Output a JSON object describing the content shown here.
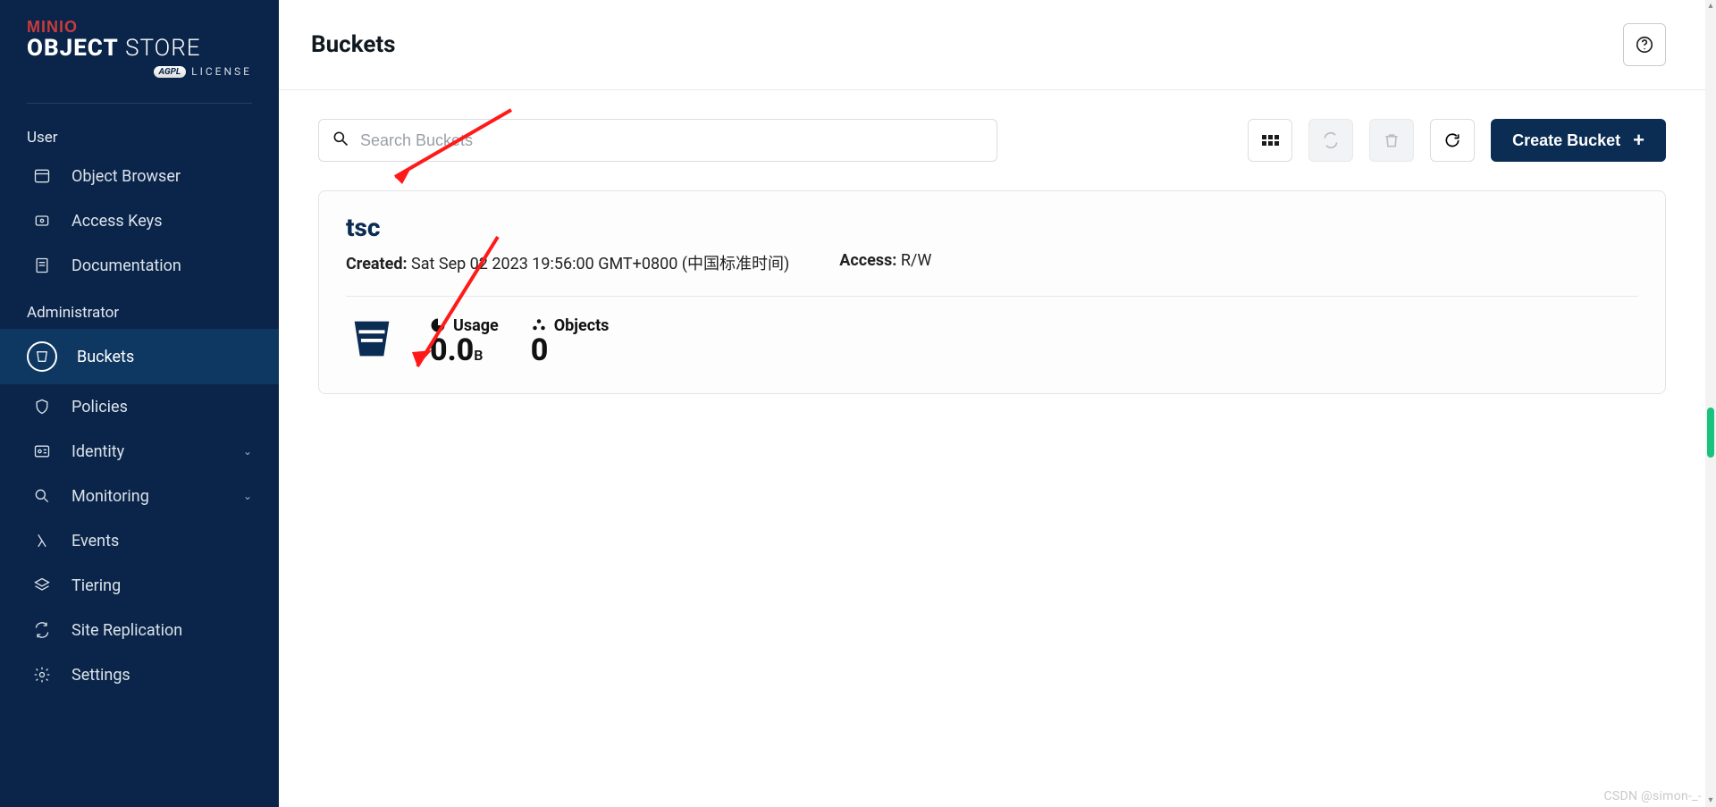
{
  "logo": {
    "brand": "MINIO",
    "title_bold": "OBJECT",
    "title_light": " STORE",
    "agpl_badge": "AGPL",
    "license_txt": "LICENSE"
  },
  "sidebar": {
    "section_user": "User",
    "section_admin": "Administrator",
    "items_user": [
      {
        "label": "Object Browser",
        "name": "sidebar-item-object-browser"
      },
      {
        "label": "Access Keys",
        "name": "sidebar-item-access-keys"
      },
      {
        "label": "Documentation",
        "name": "sidebar-item-documentation"
      }
    ],
    "items_admin": [
      {
        "label": "Buckets",
        "name": "sidebar-item-buckets",
        "active": true
      },
      {
        "label": "Policies",
        "name": "sidebar-item-policies"
      },
      {
        "label": "Identity",
        "name": "sidebar-item-identity",
        "chevron": true
      },
      {
        "label": "Monitoring",
        "name": "sidebar-item-monitoring",
        "chevron": true
      },
      {
        "label": "Events",
        "name": "sidebar-item-events"
      },
      {
        "label": "Tiering",
        "name": "sidebar-item-tiering"
      },
      {
        "label": "Site Replication",
        "name": "sidebar-item-site-replication"
      },
      {
        "label": "Settings",
        "name": "sidebar-item-settings"
      }
    ]
  },
  "header": {
    "title": "Buckets"
  },
  "toolbar": {
    "search_placeholder": "Search Buckets",
    "create_label": "Create Bucket"
  },
  "bucket": {
    "name": "tsc",
    "created_label": "Created:",
    "created_value": "Sat Sep 02 2023 19:56:00 GMT+0800 (中国标准时间)",
    "access_label": "Access:",
    "access_value": "R/W",
    "usage_label": "Usage",
    "usage_value": "0.0",
    "usage_unit": "B",
    "objects_label": "Objects",
    "objects_value": "0"
  },
  "watermark": "CSDN @simon-_-"
}
